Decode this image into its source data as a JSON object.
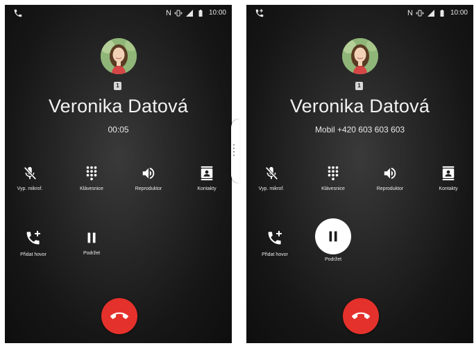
{
  "screens": [
    {
      "id": "left",
      "status_bar": {
        "nfc": "N",
        "time": "10:00"
      },
      "sim_badge": "1",
      "contact_name": "Veronika Datová",
      "call_status": "00:05",
      "buttons": {
        "mute": "Vyp. mikrof.",
        "keypad": "Klávesnice",
        "speaker": "Reproduktor",
        "contacts": "Kontakty",
        "add_call": "Přidat hovor",
        "hold": "Podržet"
      },
      "hold_active": false
    },
    {
      "id": "right",
      "status_bar": {
        "nfc": "N",
        "time": "10:00"
      },
      "sim_badge": "1",
      "contact_name": "Veronika Datová",
      "call_status": "Mobil +420 603 603 603",
      "buttons": {
        "mute": "Vyp. mikrof.",
        "keypad": "Klávesnice",
        "speaker": "Reproduktor",
        "contacts": "Kontakty",
        "add_call": "Přidat hovor",
        "hold": "Podržet"
      },
      "hold_active": true
    }
  ],
  "icons": {
    "status_left": "phone-icon",
    "status_left_right_screen": "phone-forward-icon",
    "mute": "mic-off-icon",
    "keypad": "dialpad-icon",
    "speaker": "speaker-icon",
    "contacts": "contacts-icon",
    "add_call": "add-call-icon",
    "hold": "pause-icon",
    "end_call": "call-end-icon"
  },
  "colors": {
    "end_call": "#e5312b",
    "background": "#1c1c1c",
    "text": "#ffffff"
  }
}
